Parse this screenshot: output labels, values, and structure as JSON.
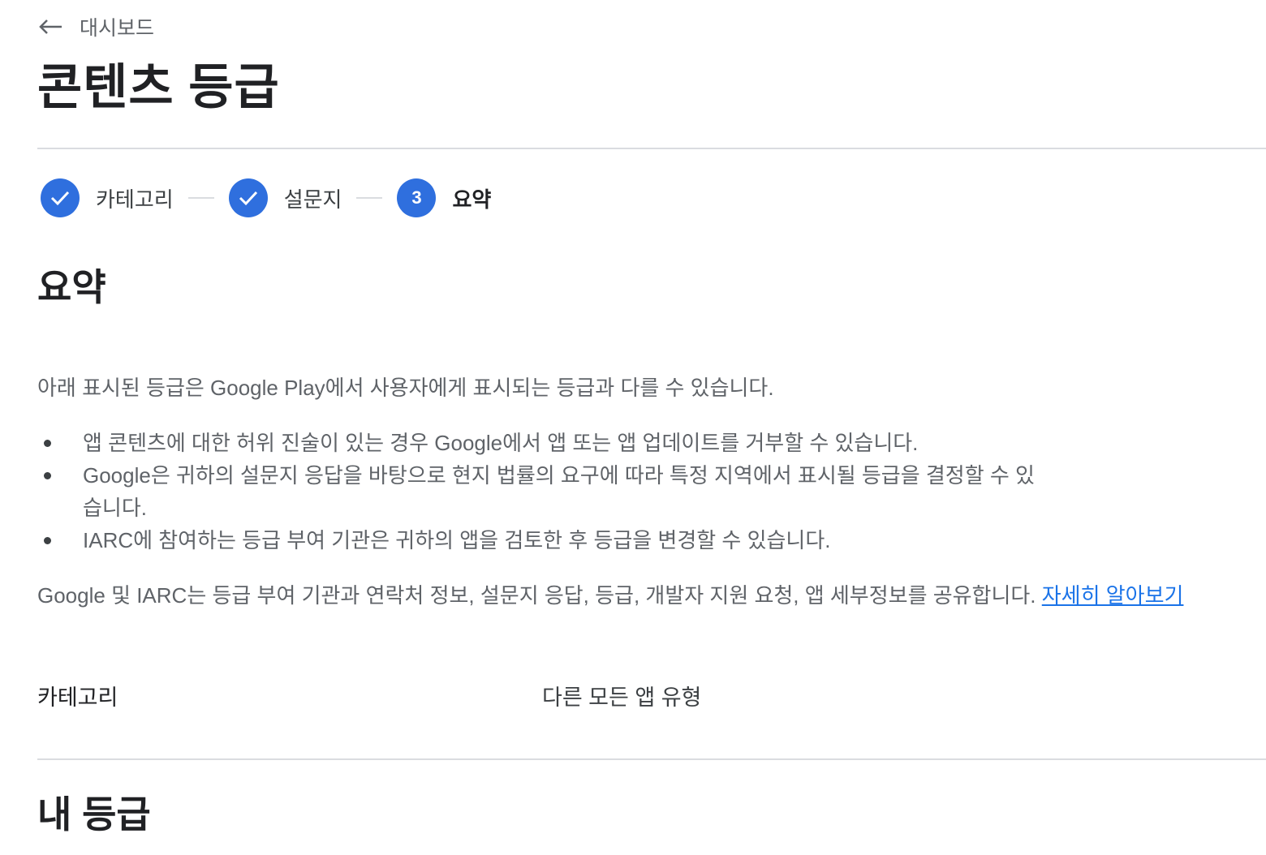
{
  "breadcrumb": {
    "label": "대시보드",
    "icon": "arrow-back-icon"
  },
  "page_title": "콘텐츠 등급",
  "stepper": {
    "steps": [
      {
        "label": "카테고리",
        "state": "complete",
        "icon": "check-icon"
      },
      {
        "label": "설문지",
        "state": "complete",
        "icon": "check-icon"
      },
      {
        "label": "요약",
        "state": "active",
        "number": "3"
      }
    ],
    "accent_color": "#2f6fde"
  },
  "summary": {
    "title": "요약",
    "intro": "아래 표시된 등급은 Google Play에서 사용자에게 표시되는 등급과 다를 수 있습니다.",
    "bullets": [
      "앱 콘텐츠에 대한 허위 진술이 있는 경우 Google에서 앱 또는 앱 업데이트를 거부할 수 있습니다.",
      "Google은 귀하의 설문지 응답을 바탕으로 현지 법률의 요구에 따라 특정 지역에서 표시될 등급을 결정할 수 있습니다.",
      "IARC에 참여하는 등급 부여 기관은 귀하의 앱을 검토한 후 등급을 변경할 수 있습니다."
    ],
    "share_text": "Google 및 IARC는 등급 부여 기관과 연락처 정보, 설문지 응답, 등급, 개발자 지원 요청, 앱 세부정보를 공유합니다. ",
    "learn_more": "자세히 알아보기",
    "link_color": "#1a73e8"
  },
  "category": {
    "label": "카테고리",
    "value": "다른 모든 앱 유형"
  },
  "my_rating": {
    "title": "내 등급"
  }
}
